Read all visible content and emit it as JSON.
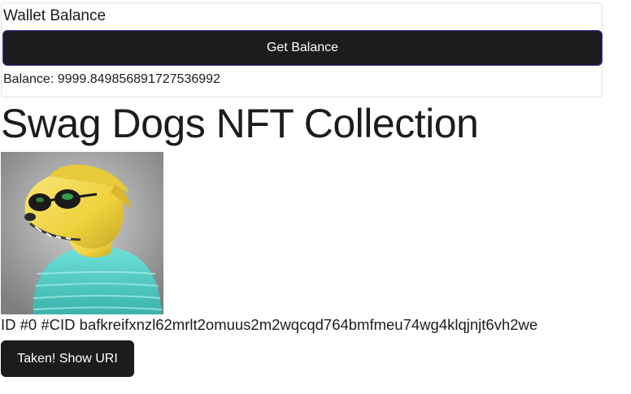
{
  "wallet": {
    "title": "Wallet Balance",
    "button_label": "Get Balance",
    "balance_label": "Balance:",
    "balance_value": "9999.849856891727536992"
  },
  "collection": {
    "title": "Swag Dogs NFT Collection"
  },
  "nft": {
    "image_description": "cartoon yellow dog with sunglasses in teal striped shirt",
    "id_text": "ID #0",
    "cid_label": "#CID",
    "cid_value": "bafkreifxnzl62mrlt2omuus2m2wqcqd764bmfmeu74wg4klqjnjt6vh2we",
    "button_label": "Taken! Show URI"
  },
  "colors": {
    "button_bg": "#1c1c1e",
    "button_text": "#ffffff",
    "focus_border": "#3a3aa8",
    "card_border": "#e2e2e2",
    "text": "#1c1c1e",
    "dog_fur": "#f2d84a",
    "shirt": "#4fc9c3"
  }
}
